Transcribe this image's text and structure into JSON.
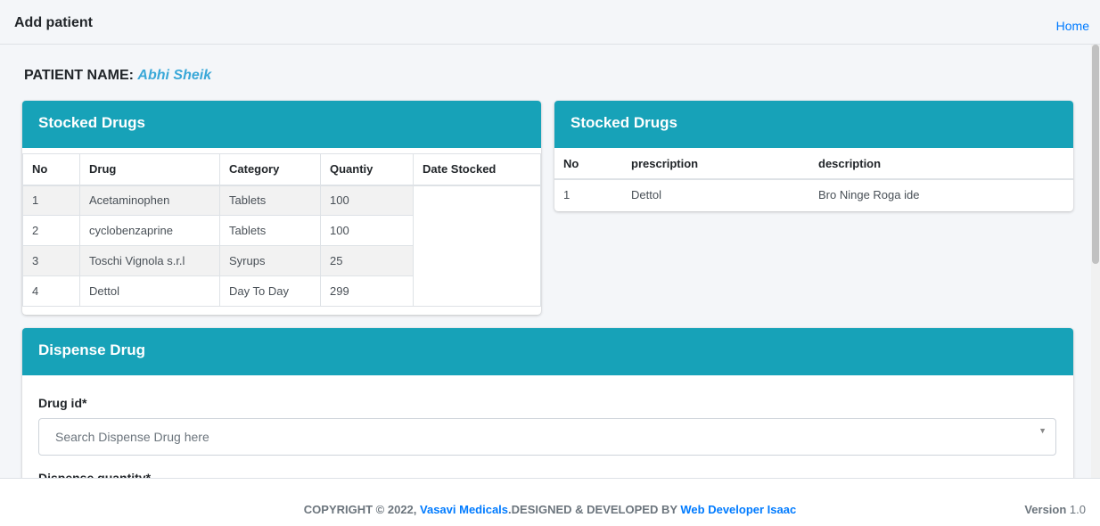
{
  "header": {
    "title": "Add patient",
    "home_link": "Home"
  },
  "patient": {
    "label": "PATIENT NAME:",
    "name": "Abhi Sheik"
  },
  "stocked_drugs": {
    "title": "Stocked Drugs",
    "columns": [
      "No",
      "Drug",
      "Category",
      "Quantiy",
      "Date Stocked"
    ],
    "rows": [
      [
        "1",
        "Acetaminophen",
        "Tablets",
        "100",
        ""
      ],
      [
        "2",
        "cyclobenzaprine",
        "Tablets",
        "100",
        ""
      ],
      [
        "3",
        "Toschi Vignola s.r.l",
        "Syrups",
        "25",
        ""
      ],
      [
        "4",
        "Dettol",
        "Day To Day",
        "299",
        ""
      ]
    ]
  },
  "prescriptions": {
    "title": "Stocked Drugs",
    "columns": [
      "No",
      "prescription",
      "description"
    ],
    "rows": [
      [
        "1",
        "Dettol",
        "Bro Ninge Roga ide"
      ]
    ]
  },
  "dispense": {
    "title": "Dispense Drug",
    "drug_id_label": "Drug id*",
    "drug_id_placeholder": "Search Dispense Drug here",
    "quantity_label": "Dispense quantity*"
  },
  "footer": {
    "copyright_prefix": "COPYRIGHT © 2022, ",
    "company": "Vasavi Medicals",
    "middle": ".DESIGNED & DEVELOPED BY ",
    "developer": "Web Developer Isaac",
    "version_label": "Version",
    "version_value": "1.0"
  },
  "colors": {
    "card_header": "#17a2b8",
    "link": "#007bff",
    "patient_name": "#3aa8d8"
  }
}
